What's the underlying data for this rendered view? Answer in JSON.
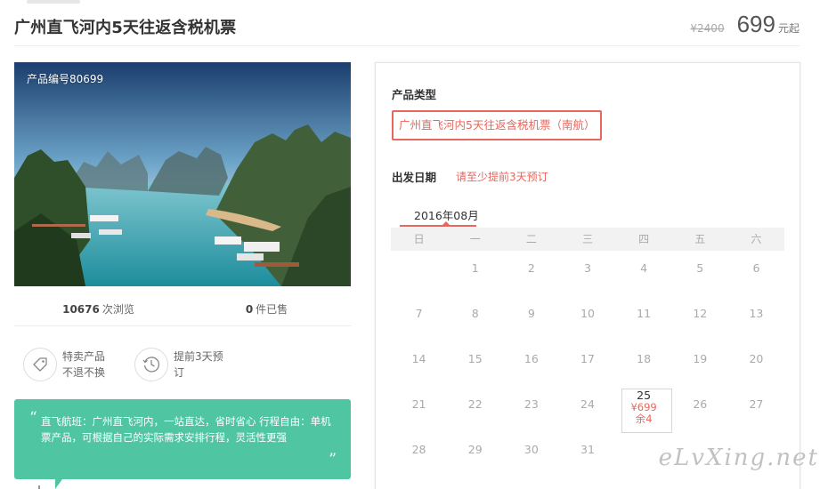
{
  "header": {
    "title": "广州直飞河内5天往返含税机票",
    "old_price": "¥2400",
    "price": "699",
    "price_unit": "元起"
  },
  "product": {
    "code_label": "产品编号80699",
    "views_count": "10676",
    "views_label": "次浏览",
    "sold_count": "0",
    "sold_label": "件已售"
  },
  "features": [
    {
      "icon": "tag-icon",
      "line1": "特卖产品",
      "line2": "不退不换"
    },
    {
      "icon": "clock-icon",
      "line1": "提前3天预",
      "line2": "订"
    }
  ],
  "promo": {
    "text": "直飞航班：广州直飞河内，一站直达，省时省心 行程自由：单机票产品，可根据自己的实际需求安排行程，灵活性更强"
  },
  "booking": {
    "type_label": "产品类型",
    "type_option": "广州直飞河内5天往返含税机票（南航）",
    "date_label": "出发日期",
    "date_hint": "请至少提前3天预订",
    "month": "2016年08月",
    "weekdays": [
      "日",
      "一",
      "二",
      "三",
      "四",
      "五",
      "六"
    ],
    "weeks": [
      [
        "",
        "1",
        "2",
        "3",
        "4",
        "5",
        "6"
      ],
      [
        "7",
        "8",
        "9",
        "10",
        "11",
        "12",
        "13"
      ],
      [
        "14",
        "15",
        "16",
        "17",
        "18",
        "19",
        "20"
      ],
      [
        "21",
        "22",
        "23",
        "24",
        "25",
        "26",
        "27"
      ],
      [
        "28",
        "29",
        "30",
        "31",
        "",
        "",
        ""
      ]
    ],
    "selected": {
      "day": "25",
      "price": "¥699",
      "stock": "余4"
    }
  },
  "watermark": "eLvXing.net",
  "colors": {
    "accent": "#e8665e",
    "promo": "#4fc5a2"
  }
}
